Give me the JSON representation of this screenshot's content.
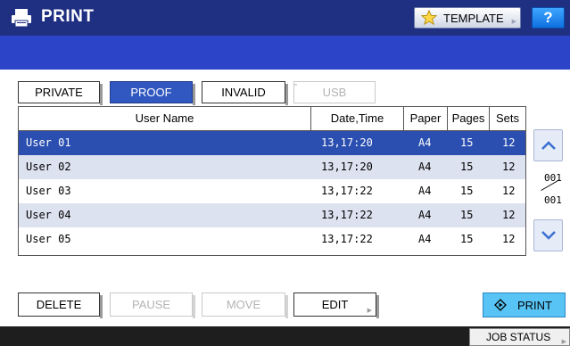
{
  "header": {
    "title": "PRINT",
    "title_icon": "printer-icon",
    "template_label": "TEMPLATE",
    "template_icon": "star-icon",
    "help_label": "?"
  },
  "colors": {
    "titlebar": "#1f2f82",
    "subbar": "#2c45c8",
    "selected_row": "#2b4fb0",
    "alt_row": "#dde2f0",
    "print_button": "#58c4f5"
  },
  "tabs": [
    {
      "label": "PRIVATE",
      "state": "normal"
    },
    {
      "label": "PROOF",
      "state": "active"
    },
    {
      "label": "INVALID",
      "state": "normal"
    },
    {
      "label": "USB",
      "state": "disabled"
    }
  ],
  "table": {
    "columns": [
      "User Name",
      "Date,Time",
      "Paper",
      "Pages",
      "Sets"
    ],
    "rows": [
      {
        "user": "User 01",
        "datetime": "13,17:20",
        "paper": "A4",
        "pages": "15",
        "sets": "12",
        "selected": true
      },
      {
        "user": "User 02",
        "datetime": "13,17:20",
        "paper": "A4",
        "pages": "15",
        "sets": "12",
        "selected": false
      },
      {
        "user": "User 03",
        "datetime": "13,17:22",
        "paper": "A4",
        "pages": "15",
        "sets": "12",
        "selected": false
      },
      {
        "user": "User 04",
        "datetime": "13,17:22",
        "paper": "A4",
        "pages": "15",
        "sets": "12",
        "selected": false
      },
      {
        "user": "User 05",
        "datetime": "13,17:22",
        "paper": "A4",
        "pages": "15",
        "sets": "12",
        "selected": false
      }
    ]
  },
  "pager": {
    "current": "001",
    "total": "001",
    "up_icon": "chevron-up-icon",
    "down_icon": "chevron-down-icon"
  },
  "actions": {
    "delete": "DELETE",
    "pause": "PAUSE",
    "move": "MOVE",
    "edit": "EDIT",
    "print": "PRINT",
    "print_icon": "diamond-start-icon"
  },
  "footer": {
    "job_status": "JOB STATUS"
  }
}
